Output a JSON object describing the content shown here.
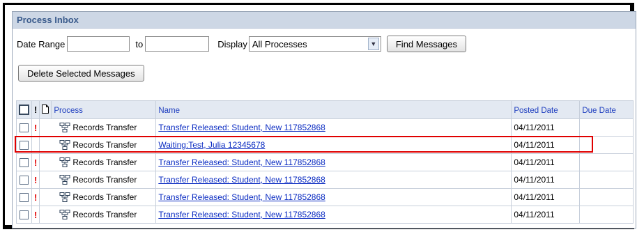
{
  "inbox": {
    "title": "Process Inbox",
    "date_range_label": "Date Range",
    "to_label": "to",
    "date_from": "",
    "date_to": "",
    "display_label": "Display",
    "display_value": "All Processes",
    "find_button": "Find Messages",
    "delete_button": "Delete Selected Messages"
  },
  "table": {
    "headers": {
      "excl": "!",
      "process": "Process",
      "name": "Name",
      "posted_date": "Posted Date",
      "due_date": "Due Date"
    },
    "rows": [
      {
        "priority": "!",
        "process": "Records Transfer",
        "name": "Transfer Released: Student, New 117852868",
        "posted_date": "04/11/2011",
        "due_date": ""
      },
      {
        "priority": "",
        "process": "Records Transfer",
        "name": "Waiting:Test, Julia 12345678",
        "posted_date": "04/11/2011",
        "due_date": ""
      },
      {
        "priority": "!",
        "process": "Records Transfer",
        "name": "Transfer Released: Student, New 117852868",
        "posted_date": "04/11/2011",
        "due_date": ""
      },
      {
        "priority": "!",
        "process": "Records Transfer",
        "name": "Transfer Released: Student, New 117852868",
        "posted_date": "04/11/2011",
        "due_date": ""
      },
      {
        "priority": "!",
        "process": "Records Transfer",
        "name": "Transfer Released: Student, New 117852868",
        "posted_date": "04/11/2011",
        "due_date": ""
      },
      {
        "priority": "!",
        "process": "Records Transfer",
        "name": "Transfer Released: Student, New 117852868",
        "posted_date": "04/11/2011",
        "due_date": ""
      }
    ]
  },
  "colors": {
    "header_bg": "#cdd7e5",
    "header_text": "#3a5b8c",
    "link": "#0b2cc2",
    "priority": "#e00000",
    "highlight": "#e00000"
  }
}
